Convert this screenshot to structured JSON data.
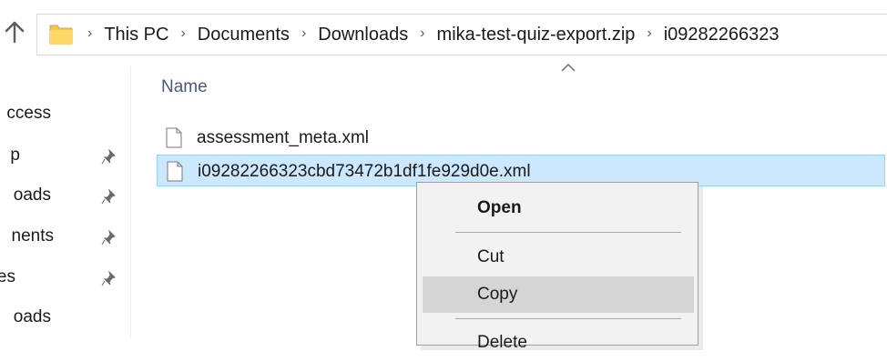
{
  "breadcrumb": {
    "items": [
      "This PC",
      "Documents",
      "Downloads",
      "mika-test-quiz-export.zip",
      "i09282266323"
    ]
  },
  "nav": {
    "items": [
      {
        "label": "ccess",
        "pinned": false
      },
      {
        "label": "p",
        "pinned": true
      },
      {
        "label": "oads",
        "pinned": true
      },
      {
        "label": "nents",
        "pinned": true
      },
      {
        "label": "es",
        "pinned": true
      },
      {
        "label": "oads",
        "pinned": false
      }
    ]
  },
  "list": {
    "column_name": "Name",
    "files": [
      {
        "name": "assessment_meta.xml",
        "selected": false
      },
      {
        "name": "i09282266323cbd73472b1df1fe929d0e.xml",
        "selected": true
      }
    ]
  },
  "context_menu": {
    "open": "Open",
    "cut": "Cut",
    "copy": "Copy",
    "delete_partial": "Delete"
  },
  "colors": {
    "selection_bg": "#cce8ff",
    "selection_border": "#99d1ff",
    "menu_bg": "#f2f2f2",
    "menu_hover": "#d5d5d5",
    "folder_yellow": "#f5c84c"
  }
}
